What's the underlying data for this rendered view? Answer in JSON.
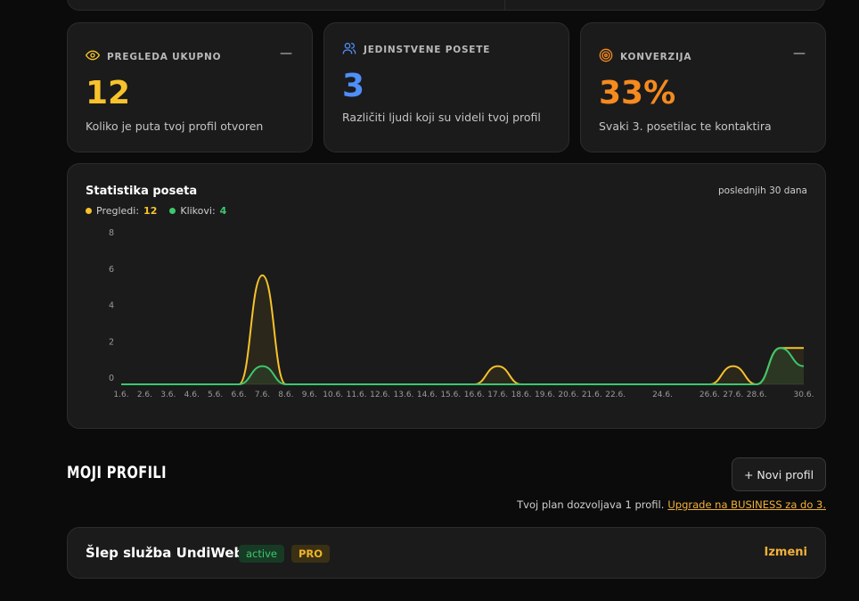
{
  "stats": [
    {
      "label": "PREGLEDA UKUPNO",
      "value": "12",
      "desc": "Koliko je puta tvoj profil otvoren",
      "color": "#f7c22c",
      "icon": "eye-icon",
      "collapse": "—"
    },
    {
      "label": "JEDINSTVENE POSETE",
      "value": "3",
      "desc": "Različiti ljudi koji su videli tvoj profil",
      "color": "#4f8ef7",
      "icon": "users-icon"
    },
    {
      "label": "KONVERZIJA",
      "value": "33%",
      "desc": "Svaki 3. posetilac te kontaktira",
      "color": "#f58a1f",
      "icon": "target-icon",
      "collapse": "—"
    }
  ],
  "chart": {
    "title": "Statistika poseta",
    "range": "poslednjih 30 dana",
    "legend": [
      {
        "label": "Pregledi:",
        "total": "12",
        "color": "#f7c22c"
      },
      {
        "label": "Klikovi:",
        "total": "4",
        "color": "#3cc86e"
      }
    ]
  },
  "chart_data": {
    "type": "line",
    "title": "Statistika poseta",
    "x": [
      "1.6.",
      "2.6.",
      "3.6.",
      "4.6.",
      "5.6.",
      "6.6.",
      "7.6.",
      "8.6.",
      "9.6.",
      "10.6.",
      "11.6.",
      "12.6.",
      "13.6.",
      "14.6.",
      "15.6.",
      "16.6.",
      "17.6.",
      "18.6.",
      "19.6.",
      "20.6.",
      "21.6.",
      "22.6.",
      "23.6.",
      "24.6.",
      "25.6.",
      "26.6.",
      "27.6.",
      "28.6.",
      "29.6.",
      "30.6."
    ],
    "x_tick_labels": [
      "1.6.",
      "2.6.",
      "3.6.",
      "4.6.",
      "5.6.",
      "6.6.",
      "7.6.",
      "8.6.",
      "9.6.",
      "10.6.",
      "11.6.",
      "12.6.",
      "13.6.",
      "14.6.",
      "15.6.",
      "16.6.",
      "17.6.",
      "18.6.",
      "19.6.",
      "20.6.",
      "21.6.",
      "22.6.",
      "",
      "24.6.",
      "",
      "26.6.",
      "27.6.",
      "28.6.",
      "",
      "30.6."
    ],
    "y_ticks": [
      0,
      2,
      4,
      6,
      8
    ],
    "ylim": [
      0,
      8
    ],
    "series": [
      {
        "name": "Pregledi",
        "color": "#f7c22c",
        "values": [
          0,
          0,
          0,
          0,
          0,
          0,
          6,
          0,
          0,
          0,
          0,
          0,
          0,
          0,
          0,
          0,
          1,
          0,
          0,
          0,
          0,
          0,
          0,
          0,
          0,
          0,
          1,
          0,
          2,
          2
        ]
      },
      {
        "name": "Klikovi",
        "color": "#3cc86e",
        "values": [
          0,
          0,
          0,
          0,
          0,
          0,
          1,
          0,
          0,
          0,
          0,
          0,
          0,
          0,
          0,
          0,
          0,
          0,
          0,
          0,
          0,
          0,
          0,
          0,
          0,
          0,
          0,
          0,
          2,
          1
        ]
      }
    ]
  },
  "profiles_section": {
    "title": "MOJI PROFILI",
    "new_button": "+ Novi profil",
    "plan_note": "Tvoj plan dozvoljava 1 profil.",
    "upgrade_link": "Upgrade na BUSINESS za do 3."
  },
  "profiles": [
    {
      "name": "Šlep služba UndiWeb",
      "status": "active",
      "plan": "PRO",
      "edit": "Izmeni"
    }
  ]
}
